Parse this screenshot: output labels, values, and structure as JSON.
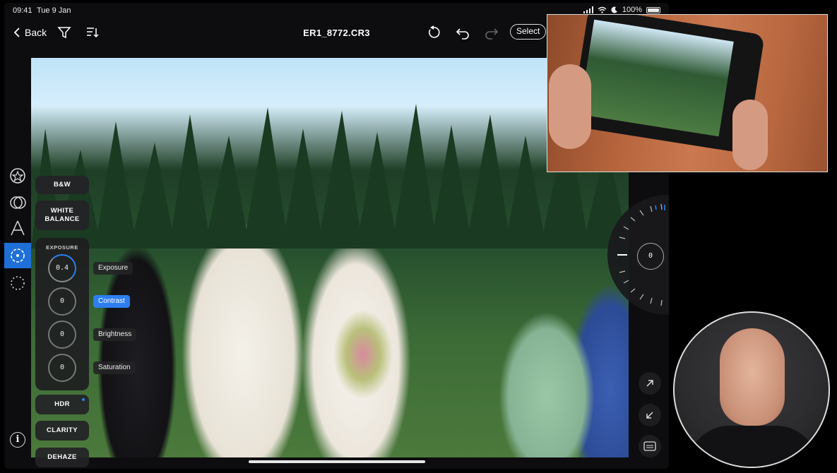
{
  "status": {
    "time": "09:41",
    "date": "Tue 9 Jan",
    "battery": "100%"
  },
  "toolbar": {
    "back_label": "Back",
    "filename": "ER1_8772.CR3",
    "select_label": "Select"
  },
  "panel": {
    "bw": "B&W",
    "white_balance_line1": "WHITE",
    "white_balance_line2": "BALANCE",
    "exposure_title": "EXPOSURE",
    "hdr": "HDR",
    "clarity": "CLARITY",
    "dehaze": "DEHAZE",
    "sliders": [
      {
        "label": "Exposure",
        "value": "0.4"
      },
      {
        "label": "Contrast",
        "value": "0"
      },
      {
        "label": "Brightness",
        "value": "0"
      },
      {
        "label": "Saturation",
        "value": "0"
      }
    ]
  },
  "dial": {
    "value": "0"
  },
  "info_label": "i",
  "colors": {
    "accent": "#2d7ef0",
    "panel": "#232326"
  }
}
